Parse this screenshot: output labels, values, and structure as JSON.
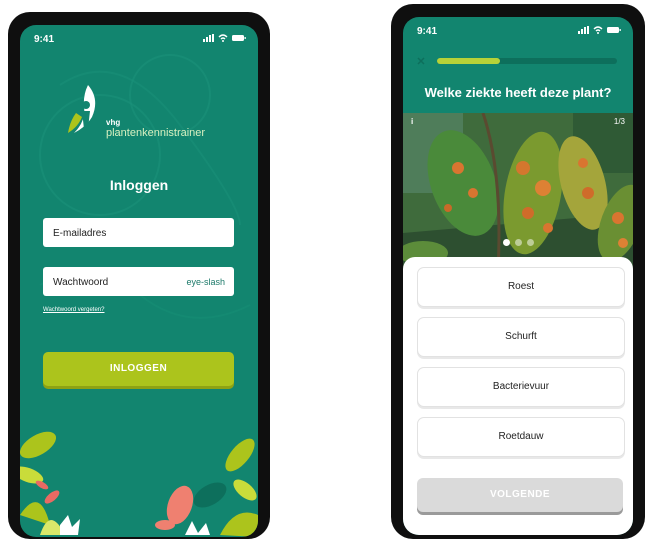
{
  "colors": {
    "brand_green": "#12856f",
    "accent_lime": "#acc41c",
    "button_disabled": "#dadada"
  },
  "login_screen": {
    "status_time": "9:41",
    "status_icons": "signal-icon wifi-icon battery-icon",
    "logo": {
      "brand_small": "vhg",
      "brand_name": "plantenkennistrainer"
    },
    "title": "Inloggen",
    "email_field": {
      "placeholder": "E-mailadres",
      "value": ""
    },
    "password_field": {
      "placeholder": "Wachtwoord",
      "value": "",
      "toggle_label": "eye-slash"
    },
    "forgot_link": "Wachtwoord vergeten?",
    "login_button": "INLOGGEN"
  },
  "quiz_screen": {
    "status_time": "9:41",
    "progress": 0.35,
    "question": "Welke ziekte heeft deze plant?",
    "image_counter": "1/3",
    "info_icon": "i",
    "answers": [
      "Roest",
      "Schurft",
      "Bacterievuur",
      "Roetdauw"
    ],
    "next_button": "VOLGENDE"
  }
}
